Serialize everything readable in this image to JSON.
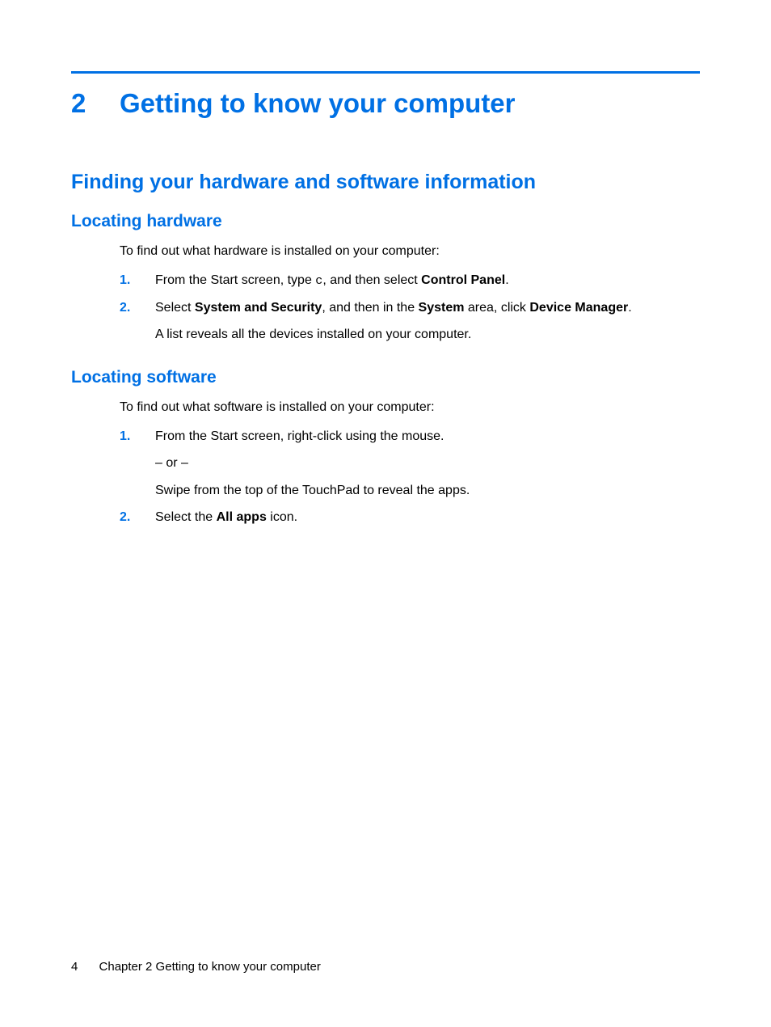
{
  "chapter": {
    "number": "2",
    "title": "Getting to know your computer"
  },
  "section": {
    "title": "Finding your hardware and software information"
  },
  "sub1": {
    "title": "Locating hardware",
    "intro": "To find out what hardware is installed on your computer:",
    "item1": {
      "marker": "1.",
      "pre": "From the Start screen, type ",
      "code": "c",
      "mid": ", and then select ",
      "bold": "Control Panel",
      "post": "."
    },
    "item2": {
      "marker": "2.",
      "t1": "Select ",
      "b1": "System and Security",
      "t2": ", and then in the ",
      "b2": "System",
      "t3": " area, click ",
      "b3": "Device Manager",
      "t4": ".",
      "line2": "A list reveals all the devices installed on your computer."
    }
  },
  "sub2": {
    "title": "Locating software",
    "intro": "To find out what software is installed on your computer:",
    "item1": {
      "marker": "1.",
      "line1": "From the Start screen, right-click using the mouse.",
      "line2": "– or –",
      "line3": "Swipe from the top of the TouchPad to reveal the apps."
    },
    "item2": {
      "marker": "2.",
      "t1": "Select the ",
      "b1": "All apps",
      "t2": " icon."
    }
  },
  "footer": {
    "page": "4",
    "text": "Chapter 2   Getting to know your computer"
  }
}
